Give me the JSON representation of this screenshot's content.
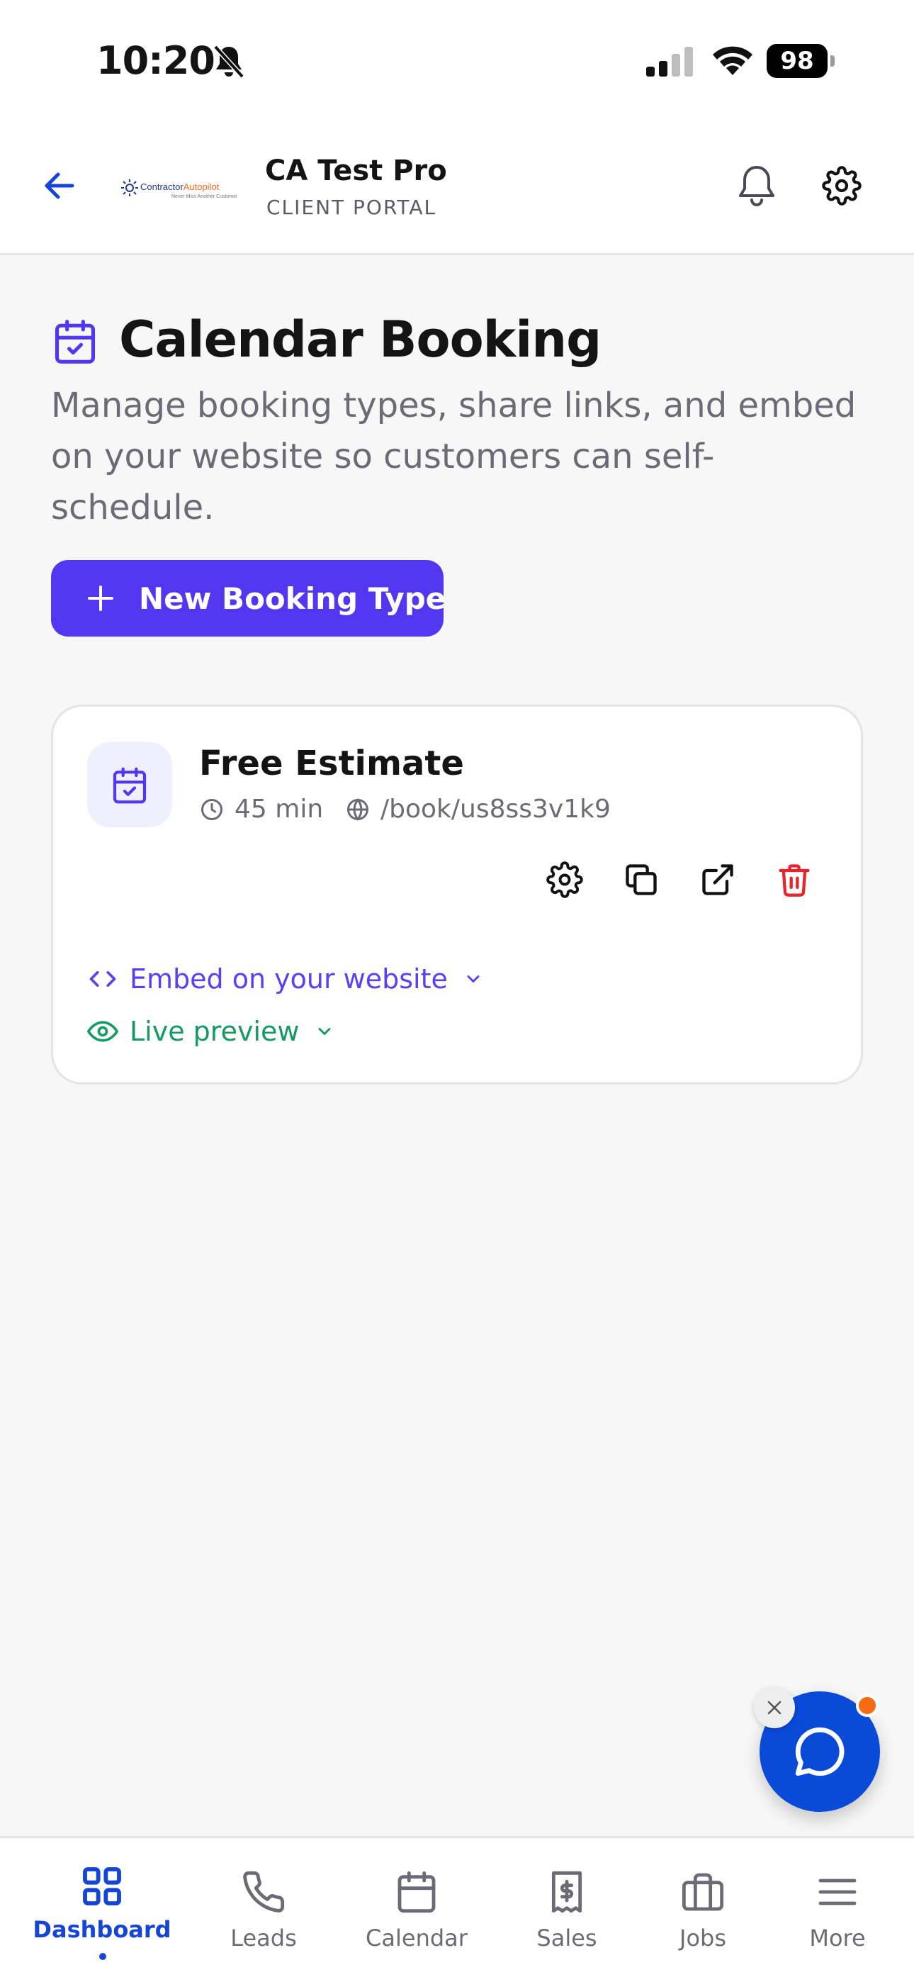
{
  "status_bar": {
    "time": "10:20",
    "battery": "98",
    "icons": [
      "bell-slash-icon",
      "cellular-signal-icon",
      "wifi-icon",
      "battery-icon"
    ]
  },
  "header": {
    "logo_text_main": "Contractor",
    "logo_text_accent": "Autopilot",
    "logo_tagline": "Never Miss Another Customer",
    "business_name": "CA Test Pro",
    "portal_label": "CLIENT PORTAL",
    "icons": [
      "back-arrow-icon",
      "bell-icon",
      "gear-icon"
    ]
  },
  "page": {
    "title": "Calendar Booking",
    "description": "Manage booking types, share links, and embed on your website so customers can self-schedule.",
    "new_button_label": "New Booking Type"
  },
  "booking_types": [
    {
      "name": "Free Estimate",
      "duration": "45 min",
      "url": "/book/us8ss3v1k9",
      "embed_label": "Embed on your website",
      "preview_label": "Live preview"
    }
  ],
  "nav": {
    "items": [
      {
        "label": "Dashboard",
        "icon": "grid-icon",
        "active": true
      },
      {
        "label": "Leads",
        "icon": "phone-icon"
      },
      {
        "label": "Calendar",
        "icon": "calendar-icon"
      },
      {
        "label": "Sales",
        "icon": "receipt-icon"
      },
      {
        "label": "Jobs",
        "icon": "briefcase-icon"
      },
      {
        "label": "More",
        "icon": "menu-icon"
      }
    ]
  },
  "colors": {
    "accent": "#5336f0",
    "nav_active": "#1645d6",
    "success": "#159a63",
    "danger": "#e5242b",
    "chat": "#0a4ad8",
    "notification_dot": "#f56a13"
  }
}
